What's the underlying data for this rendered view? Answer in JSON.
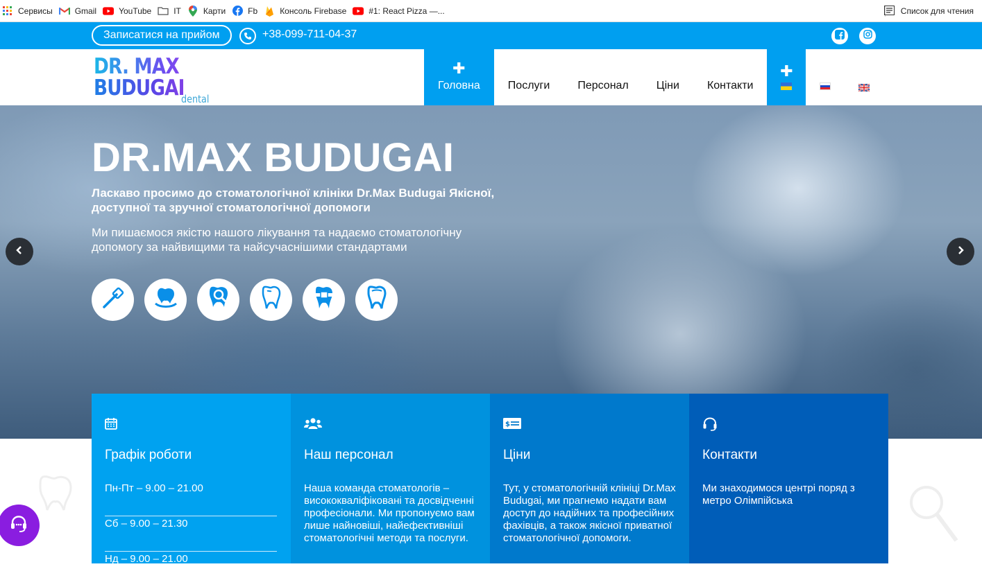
{
  "bookmarks": [
    {
      "label": "Сервисы",
      "icon": "apps-grid-icon"
    },
    {
      "label": "Gmail",
      "icon": "gmail-icon"
    },
    {
      "label": "YouTube",
      "icon": "youtube-icon"
    },
    {
      "label": "IT",
      "icon": "folder-icon"
    },
    {
      "label": "Карти",
      "icon": "maps-pin-icon"
    },
    {
      "label": "Fb",
      "icon": "facebook-icon"
    },
    {
      "label": "Консоль Firebase",
      "icon": "firebase-icon"
    },
    {
      "label": "#1: React Pizza —...",
      "icon": "youtube-icon"
    }
  ],
  "reading_list": "Список для чтения",
  "topbar": {
    "appointment": "Записатися на прийом",
    "phone": "+38-099-711-04-37"
  },
  "logo": {
    "line1": "DR. MAX",
    "line2": "BUDUGAI",
    "sub": "dental clinic"
  },
  "nav": {
    "home": "Головна",
    "services": "Послуги",
    "staff": "Персонал",
    "prices": "Ціни",
    "contacts": "Контакти"
  },
  "hero": {
    "title": "DR.MAX BUDUGAI",
    "lead": "Ласкаво просимо до стоматологічної клініки Dr.Max Budugai Якісної, доступної та зручної стоматологічної допомоги",
    "desc": "Ми пишаємося якістю нашого лікування та надаємо стоматологічну допомогу за найвищими та найсучаснішими стандартами"
  },
  "cards": {
    "schedule": {
      "title": "Графік роботи",
      "rows": [
        "Пн-Пт – 9.00 – 21.00",
        "Сб – 9.00 – 21.30",
        "Нд – 9.00 – 21.00"
      ]
    },
    "staff": {
      "title": "Наш персонал",
      "text": "Наша команда стоматологів – висококваліфіковані та досвідченні професіонали. Ми пропонуємо вам лише найновіші, найефективніші стоматологічні методи та послуги."
    },
    "prices": {
      "title": "Ціни",
      "text": "Тут, у стоматологічній клініці Dr.Max Budugai, ми прагнемо надати вам доступ до надійних та професійних фахівців, а також якісної приватної стоматологічної допомоги."
    },
    "contacts": {
      "title": "Контакти",
      "text": "Ми знаходимося центрі поряд з метро Олімпійська"
    }
  },
  "colors": {
    "brand_blue": "#009ff0",
    "card1": "#00a2f0",
    "card2": "#0092de",
    "card3": "#0079cc",
    "card4": "#005db8",
    "support": "#8a1de0"
  }
}
